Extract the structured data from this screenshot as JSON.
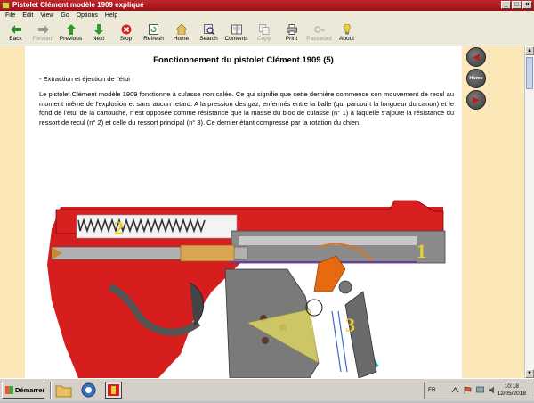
{
  "window": {
    "title": "Pistolet Clément modèle 1909 expliqué",
    "controls": [
      "_",
      "□",
      "×"
    ]
  },
  "menu": [
    "File",
    "Edit",
    "View",
    "Go",
    "Options",
    "Help"
  ],
  "toolbar": [
    {
      "label": "Back",
      "icon": "back-arrow-icon",
      "enabled": true
    },
    {
      "label": "Forward",
      "icon": "forward-arrow-icon",
      "enabled": false
    },
    {
      "label": "Previous",
      "icon": "up-arrow-icon",
      "enabled": true
    },
    {
      "label": "Next",
      "icon": "down-arrow-icon",
      "enabled": true
    },
    {
      "label": "Stop",
      "icon": "stop-icon",
      "enabled": true
    },
    {
      "label": "Refresh",
      "icon": "refresh-icon",
      "enabled": true
    },
    {
      "label": "Home",
      "icon": "home-icon",
      "enabled": true
    },
    {
      "label": "Search",
      "icon": "search-icon",
      "enabled": true
    },
    {
      "label": "Contents",
      "icon": "contents-icon",
      "enabled": true
    },
    {
      "label": "Copy",
      "icon": "copy-icon",
      "enabled": false
    },
    {
      "label": "Print",
      "icon": "print-icon",
      "enabled": true
    },
    {
      "label": "Password",
      "icon": "password-icon",
      "enabled": false
    },
    {
      "label": "About",
      "icon": "about-icon",
      "enabled": true
    }
  ],
  "page": {
    "title": "Fonctionnement du pistolet Clément 1909 (5)",
    "section": "- Extraction et éjection de l'étui",
    "paragraph": "Le pistolet Clément modèle 1909 fonctionne à culasse non calée. Ce qui signifie que cette dernière commence son mouvement de recul au moment même de l'explosion et sans aucun retard. A la pression des gaz, enfermés entre la balle (qui parcourt la longueur du canon) et le fond de l'étui de la cartouche, n'est opposée comme résistance que la masse du bloc de culasse (n° 1) à laquelle s'ajoute la résistance du ressort de recul (n° 2) et celle du ressort principal (n° 3). Ce dernier étant compressé par la rotation du chien.",
    "diagram_labels": [
      "1",
      "2",
      "3"
    ]
  },
  "nav": {
    "prev_icon": "left-arrow-icon",
    "home_label": "Home",
    "next_icon": "right-arrow-icon"
  },
  "taskbar": {
    "start_label": "Démarrer",
    "language": "FR",
    "time": "10:18",
    "date": "12/05/2018"
  },
  "colors": {
    "title_bar": "#b51d22",
    "page_background": "#ffffff",
    "margin": "#fbe7b8"
  }
}
